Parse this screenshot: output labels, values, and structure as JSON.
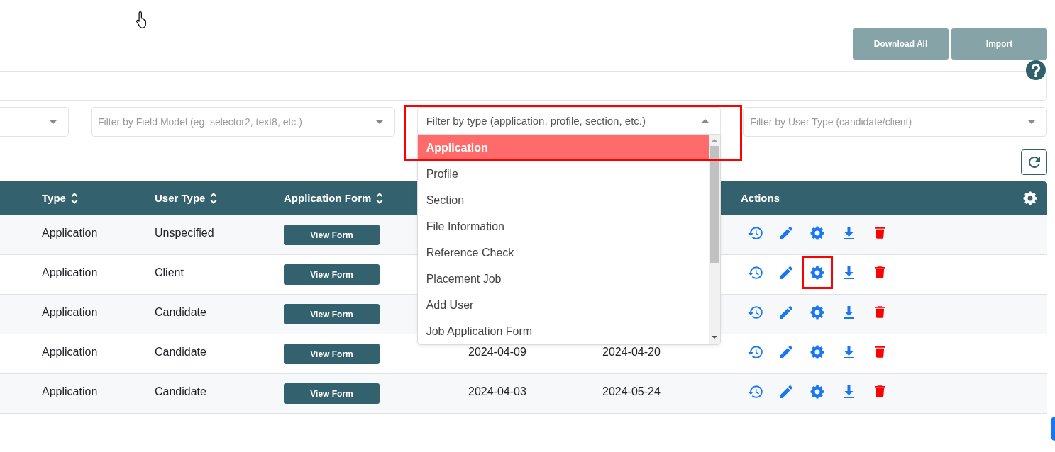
{
  "toolbar": {
    "buttons": [
      "Download All",
      "Import"
    ]
  },
  "filters": [
    {
      "expanded": false,
      "highlighted": false
    },
    {
      "placeholder": "Filter by Field Model (eg. selector2, text8, etc.)",
      "expanded": false,
      "highlighted": false
    },
    {
      "placeholder": "Filter by type (application, profile, section, etc.)",
      "expanded": true,
      "highlighted": true,
      "options": [
        {
          "label": "Application",
          "selected": true
        },
        {
          "label": "Profile",
          "selected": false
        },
        {
          "label": "Section",
          "selected": false
        },
        {
          "label": "File Information",
          "selected": false
        },
        {
          "label": "Reference Check",
          "selected": false
        },
        {
          "label": "Placement Job",
          "selected": false
        },
        {
          "label": "Add User",
          "selected": false
        },
        {
          "label": "Job Application Form",
          "selected": false
        }
      ]
    },
    {
      "placeholder": "Filter by User Type (candidate/client)",
      "expanded": false,
      "highlighted": false
    }
  ],
  "table": {
    "columns": [
      {
        "label": "Type",
        "sortable": true
      },
      {
        "label": "User Type",
        "sortable": true
      },
      {
        "label": "Application Form",
        "sortable": true
      },
      {
        "label": "Actions",
        "sortable": false
      }
    ],
    "rows": [
      {
        "type": "Application",
        "user_type": "Unspecified",
        "form_button": "View Form",
        "actions": [
          {
            "kind": "history",
            "highlighted": false
          },
          {
            "kind": "edit",
            "highlighted": false
          },
          {
            "kind": "settings",
            "highlighted": false
          },
          {
            "kind": "download",
            "highlighted": false
          },
          {
            "kind": "delete",
            "highlighted": false
          }
        ]
      },
      {
        "type": "Application",
        "user_type": "Client",
        "form_button": "View Form",
        "actions": [
          {
            "kind": "history",
            "highlighted": false
          },
          {
            "kind": "edit",
            "highlighted": false
          },
          {
            "kind": "settings",
            "highlighted": true
          },
          {
            "kind": "download",
            "highlighted": false
          },
          {
            "kind": "delete",
            "highlighted": false
          }
        ]
      },
      {
        "type": "Application",
        "user_type": "Candidate",
        "form_button": "View Form",
        "actions": [
          {
            "kind": "history",
            "highlighted": false
          },
          {
            "kind": "edit",
            "highlighted": false
          },
          {
            "kind": "settings",
            "highlighted": false
          },
          {
            "kind": "download",
            "highlighted": false
          },
          {
            "kind": "delete",
            "highlighted": false
          }
        ]
      },
      {
        "type": "Application",
        "user_type": "Candidate",
        "form_button": "View Form",
        "dates": [
          "2024-04-09",
          "2024-04-20"
        ],
        "actions": [
          {
            "kind": "history",
            "highlighted": false
          },
          {
            "kind": "edit",
            "highlighted": false
          },
          {
            "kind": "settings",
            "highlighted": false
          },
          {
            "kind": "download",
            "highlighted": false
          },
          {
            "kind": "delete",
            "highlighted": false
          }
        ]
      },
      {
        "type": "Application",
        "user_type": "Candidate",
        "form_button": "View Form",
        "dates": [
          "2024-04-03",
          "2024-05-24"
        ],
        "actions": [
          {
            "kind": "history",
            "highlighted": false
          },
          {
            "kind": "edit",
            "highlighted": false
          },
          {
            "kind": "settings",
            "highlighted": false
          },
          {
            "kind": "download",
            "highlighted": false
          },
          {
            "kind": "delete",
            "highlighted": false
          }
        ]
      }
    ]
  }
}
